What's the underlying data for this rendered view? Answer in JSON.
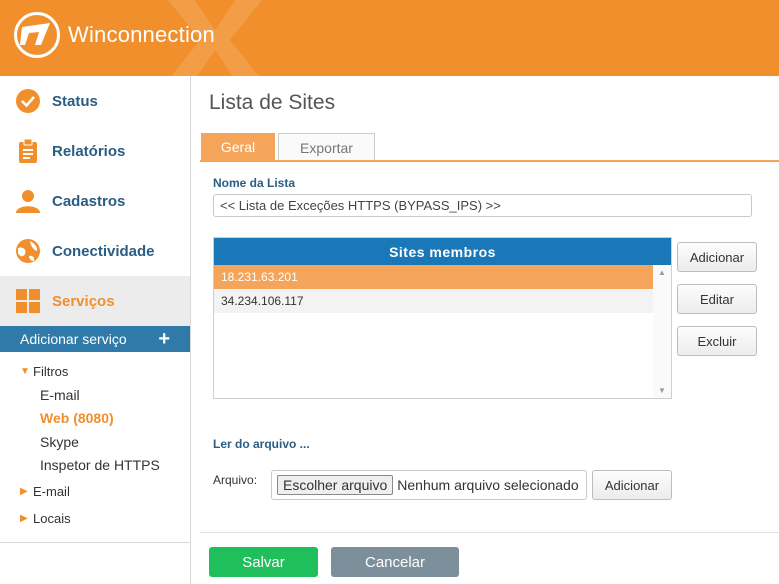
{
  "header": {
    "brand": "Winconnection",
    "accent": "#f08f2c"
  },
  "sidebar": {
    "items": [
      {
        "label": "Status",
        "icon": "check-circle-icon"
      },
      {
        "label": "Relatórios",
        "icon": "clipboard-icon"
      },
      {
        "label": "Cadastros",
        "icon": "user-icon"
      },
      {
        "label": "Conectividade",
        "icon": "globe-icon"
      },
      {
        "label": "Serviços",
        "icon": "grid-icon"
      }
    ],
    "add_service": "Adicionar serviço",
    "tree": {
      "filtros": "Filtros",
      "filtros_children": [
        "E-mail",
        "Web (8080)",
        "Skype",
        "Inspetor de HTTPS"
      ],
      "email": "E-mail",
      "locais": "Locais"
    }
  },
  "main": {
    "title": "Lista de Sites",
    "tabs": [
      "Geral",
      "Exportar"
    ],
    "list_name_label": "Nome da Lista",
    "list_name_value": "<< Lista de Exceções HTTPS (BYPASS_IPS) >>",
    "members_header": "Sites membros",
    "members": [
      "18.231.63.201",
      "34.234.106.117"
    ],
    "buttons": {
      "add": "Adicionar",
      "edit": "Editar",
      "delete": "Excluir"
    },
    "read_file_label": "Ler do arquivo ...",
    "file_label": "Arquivo:",
    "file_choose": "Escolher arquivo",
    "file_none": "Nenhum arquivo selecionado",
    "file_add": "Adicionar",
    "save": "Salvar",
    "cancel": "Cancelar"
  }
}
